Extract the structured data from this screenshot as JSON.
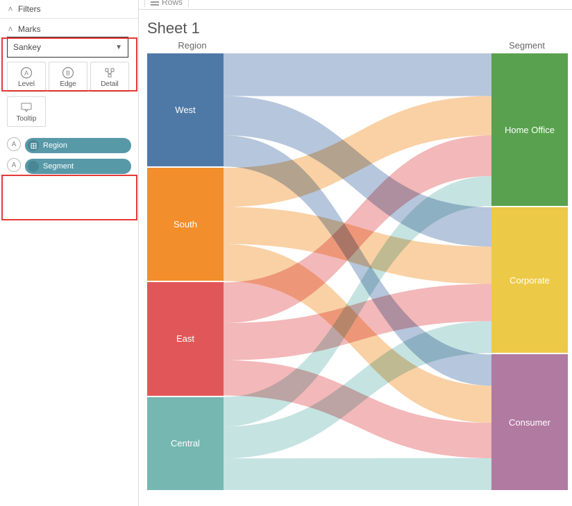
{
  "top_shelf": {
    "rows_label": "Rows"
  },
  "sidebar": {
    "filters_label": "Filters",
    "marks_label": "Marks",
    "mark_type": "Sankey",
    "buttons": {
      "level": "Level",
      "edge": "Edge",
      "detail": "Detail",
      "tooltip": "Tooltip"
    },
    "pills": [
      {
        "label": "Region",
        "level_letter": "A"
      },
      {
        "label": "Segment",
        "level_letter": "A"
      }
    ]
  },
  "sheet_title": "Sheet 1",
  "header_left": "Region",
  "header_right": "Segment",
  "chart_data": {
    "type": "sankey",
    "left_nodes": [
      {
        "name": "West",
        "color": "#4e79a7",
        "size": 170
      },
      {
        "name": "South",
        "color": "#f28e2b",
        "size": 170
      },
      {
        "name": "East",
        "color": "#e15759",
        "size": 170
      },
      {
        "name": "Central",
        "color": "#76b7b2",
        "size": 140
      }
    ],
    "right_nodes": [
      {
        "name": "Home Office",
        "color": "#59a14f",
        "size": 225
      },
      {
        "name": "Corporate",
        "color": "#edc948",
        "size": 215
      },
      {
        "name": "Consumer",
        "color": "#b07aa1",
        "size": 200
      }
    ],
    "links": [
      {
        "from": "West",
        "to": "Home Office",
        "value": 63,
        "color": "#8fa7c9"
      },
      {
        "from": "West",
        "to": "Corporate",
        "value": 58,
        "color": "#8fa7c9"
      },
      {
        "from": "West",
        "to": "Consumer",
        "value": 46,
        "color": "#8fa7c9"
      },
      {
        "from": "South",
        "to": "Home Office",
        "value": 58,
        "color": "#f6b974"
      },
      {
        "from": "South",
        "to": "Corporate",
        "value": 55,
        "color": "#f6b974"
      },
      {
        "from": "South",
        "to": "Consumer",
        "value": 55,
        "color": "#f6b974"
      },
      {
        "from": "East",
        "to": "Home Office",
        "value": 60,
        "color": "#ec9293"
      },
      {
        "from": "East",
        "to": "Corporate",
        "value": 55,
        "color": "#ec9293"
      },
      {
        "from": "East",
        "to": "Consumer",
        "value": 52,
        "color": "#ec9293"
      },
      {
        "from": "Central",
        "to": "Home Office",
        "value": 44,
        "color": "#a6d4d1"
      },
      {
        "from": "Central",
        "to": "Corporate",
        "value": 47,
        "color": "#a6d4d1"
      },
      {
        "from": "Central",
        "to": "Consumer",
        "value": 47,
        "color": "#a6d4d1"
      }
    ]
  }
}
